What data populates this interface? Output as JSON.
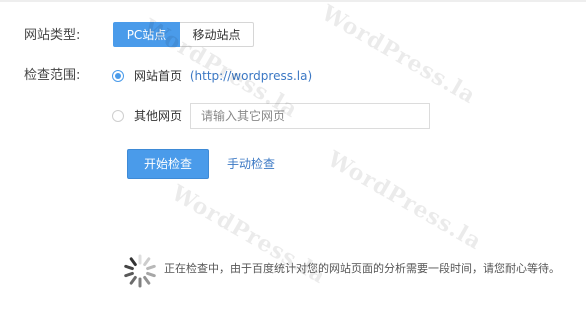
{
  "form": {
    "site_type_label": "网站类型:",
    "scope_label": "检查范围:"
  },
  "site_type": {
    "options": [
      {
        "label": "PC站点",
        "selected": true
      },
      {
        "label": "移动站点",
        "selected": false
      }
    ]
  },
  "scope": {
    "homepage_label": "网站首页",
    "homepage_url": "(http://wordpress.la)",
    "homepage_selected": true,
    "other_label": "其他网页",
    "other_selected": false,
    "other_placeholder": "请输入其它网页",
    "other_value": ""
  },
  "actions": {
    "start_label": "开始检查",
    "manual_label": "手动检查"
  },
  "status": {
    "message": "正在检查中，由于百度统计对您的网站页面的分析需要一段时间，请您耐心等待。"
  },
  "watermark": {
    "text": "WordPress.la"
  },
  "colors": {
    "accent": "#4a9bea",
    "link": "#3b78c4",
    "border": "#dcdcdc",
    "spinner": "#333333"
  },
  "icons": {
    "spinner": "loading-spinner-icon",
    "radio_checked": "radio-checked-icon",
    "radio_unchecked": "radio-unchecked-icon"
  }
}
